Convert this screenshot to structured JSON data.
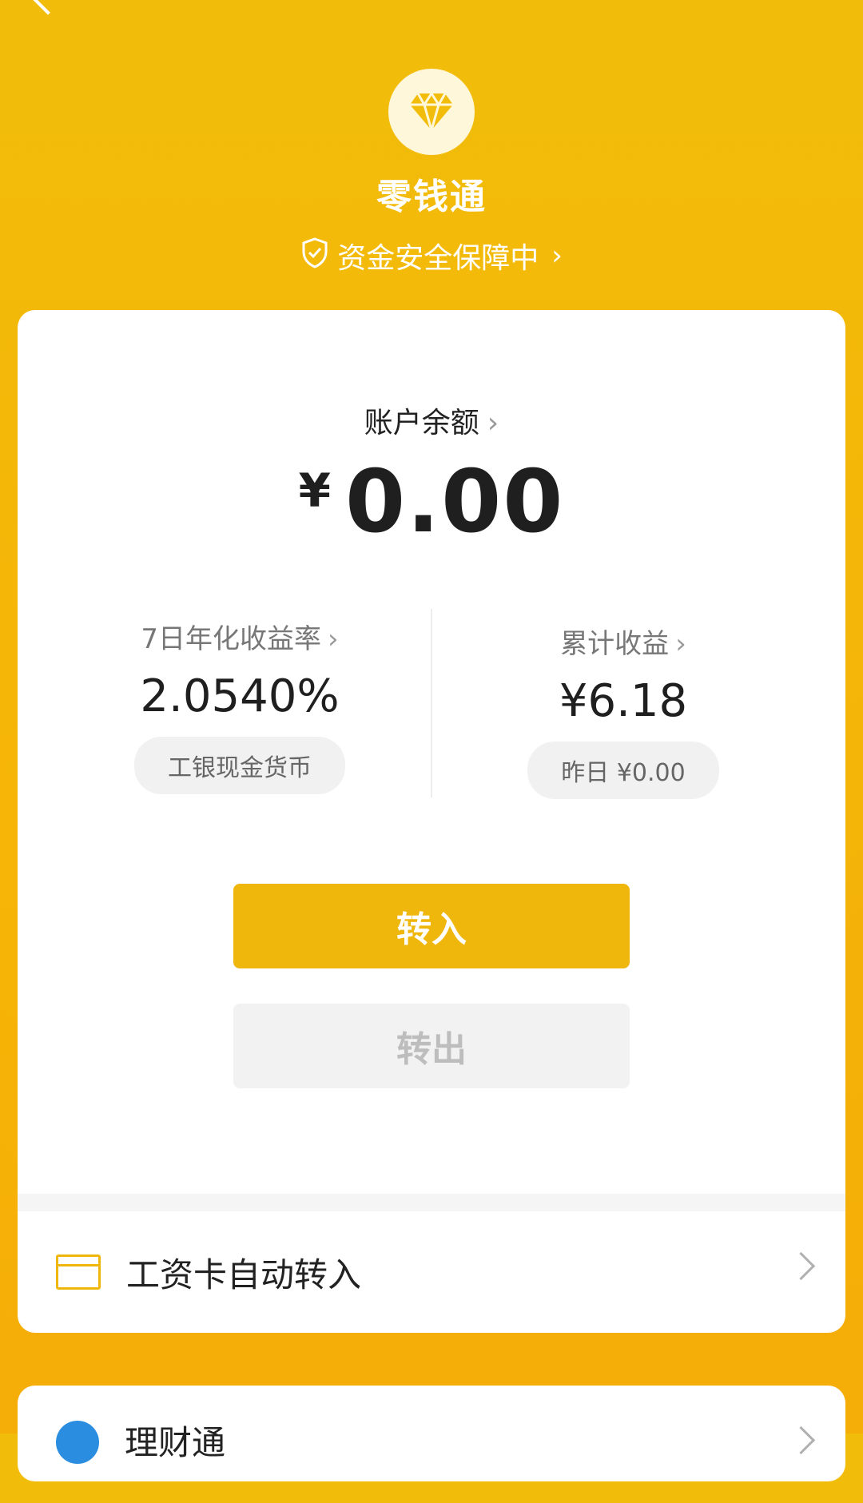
{
  "header": {
    "title": "零钱通",
    "safety_text": "资金安全保障中",
    "icons": {
      "back": "back-arrow-icon",
      "more": "more-dots-icon",
      "logo": "diamond-icon",
      "shield": "shield-check-icon"
    }
  },
  "balance": {
    "label": "账户余额",
    "currency": "¥",
    "amount": "0.00"
  },
  "stats": {
    "yield": {
      "label": "7日年化收益率",
      "value": "2.0540%",
      "pill": "工银现金货币"
    },
    "earnings": {
      "label": "累计收益",
      "value": "¥6.18",
      "pill": "昨日 ¥0.00"
    }
  },
  "actions": {
    "transfer_in": "转入",
    "transfer_out": "转出"
  },
  "salary_row": {
    "label": "工资卡自动转入",
    "icon": "card-icon"
  },
  "next_card": {
    "label": "理财通"
  },
  "colors": {
    "accent": "#efb70c",
    "background": "#f4b608",
    "card": "#ffffff"
  }
}
